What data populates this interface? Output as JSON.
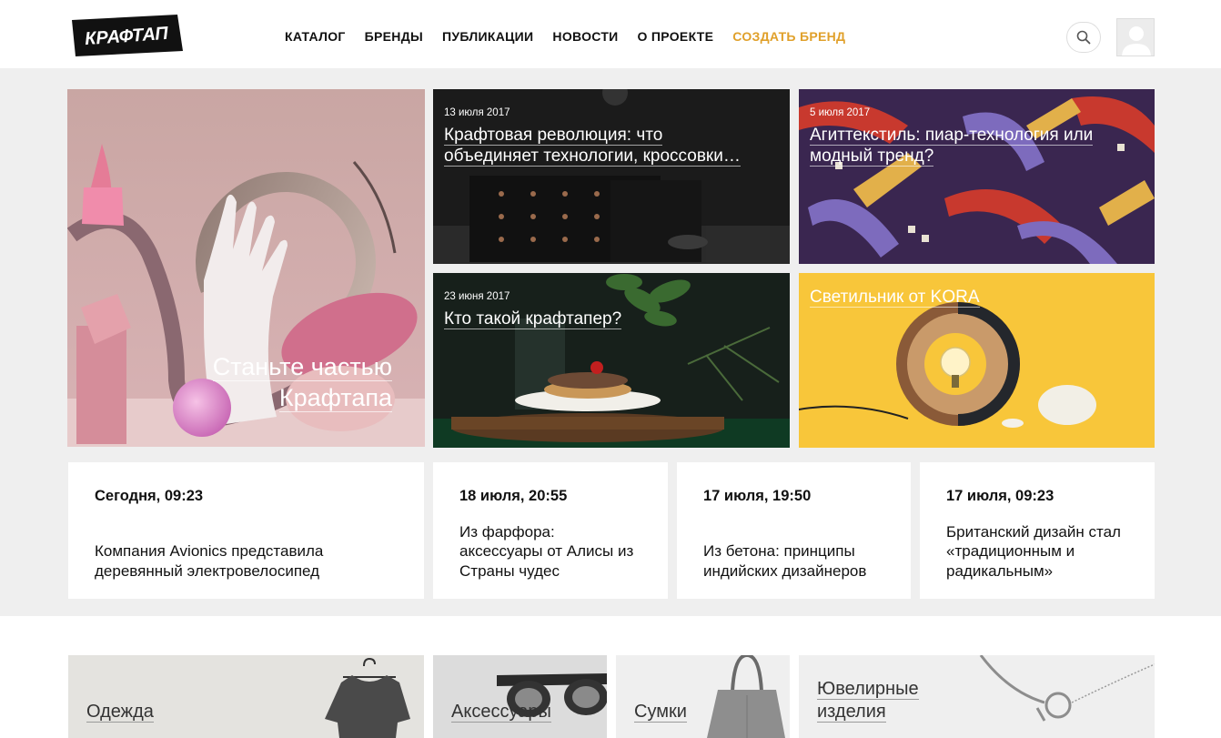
{
  "header": {
    "logo_text": "КРАФТАП",
    "nav": [
      {
        "label": "КАТАЛОГ"
      },
      {
        "label": "БРЕНДЫ"
      },
      {
        "label": "ПУБЛИКАЦИИ"
      },
      {
        "label": "НОВОСТИ"
      },
      {
        "label": "О ПРОЕКТЕ"
      },
      {
        "label": "СОЗДАТЬ БРЕНД"
      }
    ],
    "accent_color": "#e0a02a"
  },
  "hero": {
    "title_line1": "Станьте частью",
    "title_line2": "Крафтапа"
  },
  "tiles": [
    {
      "date": "13 июля 2017",
      "title_line1": "Крафтовая революция: что",
      "title_line2": "объединяет технологии, кроссовки…"
    },
    {
      "date": "5 июля 2017",
      "title_line1": "Агиттекстиль: пиар-технология или",
      "title_line2": "модный тренд?"
    },
    {
      "date": "23 июня 2017",
      "title_line1": "Кто такой крафтапер?",
      "title_line2": ""
    },
    {
      "date": "",
      "title_line1": "Светильник от KORA",
      "title_line2": ""
    }
  ],
  "news": [
    {
      "date": "Сегодня, 09:23",
      "line1": "Компания Avionics представила",
      "line2": "деревянный электровелосипед",
      "line3": ""
    },
    {
      "date": "18 июля, 20:55",
      "line1": "Из фарфора:",
      "line2": "аксессуары от Алисы из",
      "line3": "Страны чудес"
    },
    {
      "date": "17 июля, 19:50",
      "line1": "Из бетона: принципы",
      "line2": "индийских дизайнеров",
      "line3": ""
    },
    {
      "date": "17 июля, 09:23",
      "line1": "Британский дизайн стал",
      "line2": "«традиционным и",
      "line3": "радикальным»"
    }
  ],
  "categories": [
    {
      "line1": "Одежда",
      "line2": ""
    },
    {
      "line1": "Аксессуары",
      "line2": ""
    },
    {
      "line1": "Сумки",
      "line2": ""
    },
    {
      "line1": "Ювелирные",
      "line2": "изделия"
    }
  ]
}
